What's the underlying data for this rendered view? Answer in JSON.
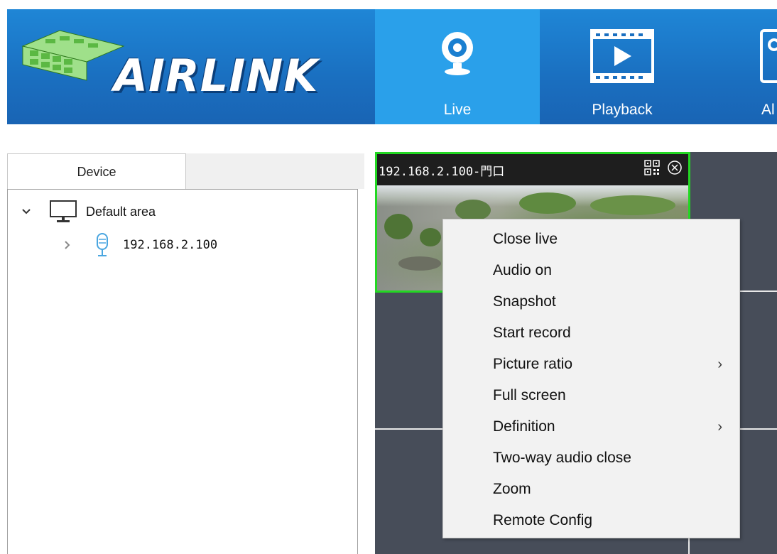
{
  "app": {
    "brand": "AIRLINK",
    "colors": {
      "header": "#1a6fc0",
      "active_tab": "#2aa0ea",
      "grid": "#474d59",
      "active_border": "#22d822"
    }
  },
  "nav": [
    {
      "label": "Live",
      "icon": "webcam-icon",
      "active": true
    },
    {
      "label": "Playback",
      "icon": "film-play-icon",
      "active": false
    },
    {
      "label": "Al",
      "icon": "image-icon",
      "active": false
    }
  ],
  "device_panel": {
    "tab_label": "Device",
    "tree": {
      "area": {
        "label": "Default area",
        "expanded": true,
        "icon": "monitor-icon"
      },
      "devices": [
        {
          "label": "192.168.2.100",
          "expanded": false,
          "icon": "microphone-icon"
        }
      ]
    }
  },
  "live_view": {
    "active_cell": {
      "title": "192.168.2.100-門口"
    }
  },
  "context_menu": {
    "items": [
      {
        "label": "Close live",
        "submenu": false
      },
      {
        "label": "Audio on",
        "submenu": false
      },
      {
        "label": "Snapshot",
        "submenu": false
      },
      {
        "label": "Start record",
        "submenu": false
      },
      {
        "label": "Picture ratio",
        "submenu": true
      },
      {
        "label": "Full screen",
        "submenu": false
      },
      {
        "label": "Definition",
        "submenu": true
      },
      {
        "label": "Two-way audio close",
        "submenu": false
      },
      {
        "label": "Zoom",
        "submenu": false
      },
      {
        "label": "Remote Config",
        "submenu": false
      }
    ]
  }
}
